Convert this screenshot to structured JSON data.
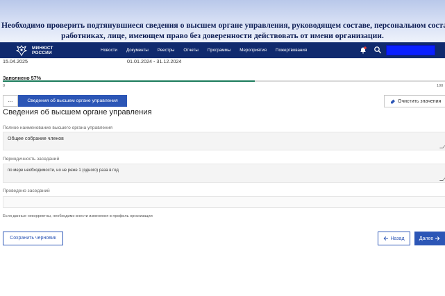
{
  "banner": {
    "line1": "Необходимо проверить подтянувшиеся сведения  о высшем органе управления, руководящем составе,  персональном составе,",
    "line2": "работниках, лице, имеющем право без доверенности действовать от имени организации."
  },
  "navbar": {
    "logo_line1": "МИНЮСТ",
    "logo_line2": "РОССИИ",
    "menu": [
      "Новости",
      "Документы",
      "Реестры",
      "Отчеты",
      "Программы",
      "Мероприятия",
      "Пожертвования"
    ],
    "colors": {
      "bar": "#102a6e",
      "highlight_box": "#0a20ff"
    }
  },
  "report": {
    "date": "15.04.2025",
    "period": "01.01.2024 - 31.12.2024"
  },
  "progress": {
    "label": "Заполнено 57%",
    "value_percent": 57,
    "min_label": "0",
    "max_label": "100"
  },
  "toolbar": {
    "more_label": "...",
    "active_tab": "Сведения об высшем органе управления",
    "clear_label": "Очистить значения"
  },
  "section": {
    "title": "Сведения об высшем органе управления"
  },
  "fields": [
    {
      "label": "Полное наименование высшего органа управления",
      "value": "Общее собрание членов"
    },
    {
      "label": "Периодичность заседаний",
      "value": "по мере необходимости, но не реже 1 (одного) раза в год"
    },
    {
      "label": "Проведено заседаний",
      "value": ""
    }
  ],
  "note": "Если данные некорректны, необходимо внести изменения в профиль организации",
  "footer": {
    "draft_label": "Сохранить черновик",
    "back_label": "Назад",
    "next_label": "Далее"
  },
  "icons": {
    "emblem": "eagle-emblem-icon",
    "notifications": "bell-icon",
    "search": "search-icon",
    "clear": "eraser-icon",
    "back": "arrow-left-icon",
    "next": "arrow-right-icon"
  }
}
